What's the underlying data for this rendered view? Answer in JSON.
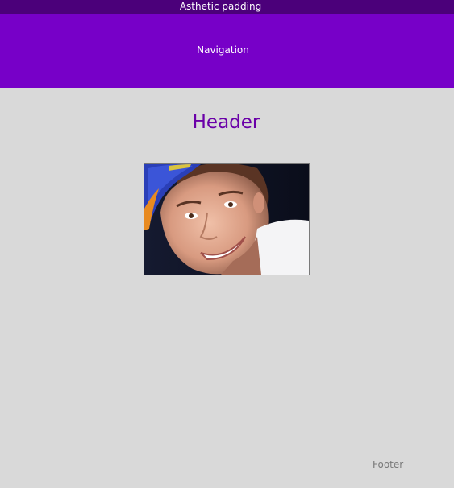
{
  "aesthetic_padding": {
    "label": "Asthetic padding"
  },
  "navigation": {
    "label": "Navigation"
  },
  "header": {
    "title": "Header"
  },
  "footer": {
    "label": "Footer"
  },
  "colors": {
    "page_background": "#d9d9d9",
    "top_bar": "#4b007a",
    "nav_bar": "#7700c8",
    "header_text": "#6a00a8",
    "footer_text": "#7a7a7a"
  },
  "image": {
    "subject": "smiling young man wearing a blue and orange cap"
  }
}
